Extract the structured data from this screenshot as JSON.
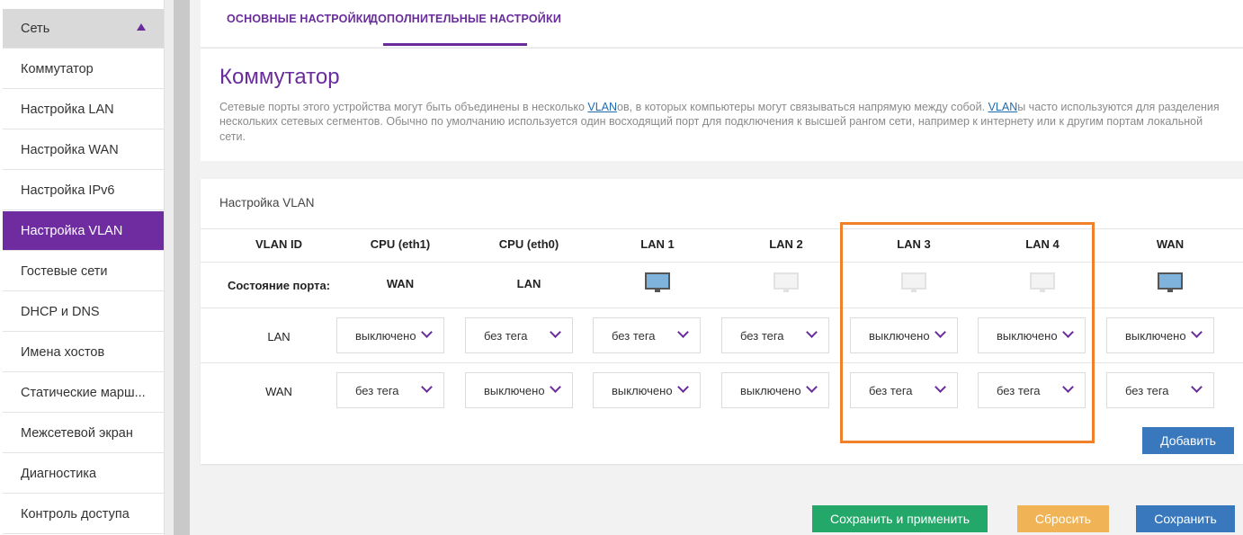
{
  "sidebar": {
    "items": [
      {
        "label": "Сеть"
      },
      {
        "label": "Коммутатор"
      },
      {
        "label": "Настройка LAN"
      },
      {
        "label": "Настройка WAN"
      },
      {
        "label": "Настройка IPv6"
      },
      {
        "label": "Настройка VLAN"
      },
      {
        "label": "Гостевые сети"
      },
      {
        "label": "DHCP и DNS"
      },
      {
        "label": "Имена хостов"
      },
      {
        "label": "Статические марш..."
      },
      {
        "label": "Межсетевой экран"
      },
      {
        "label": "Диагностика"
      },
      {
        "label": "Контроль доступа"
      }
    ]
  },
  "tabs": [
    {
      "label": "ОСНОВНЫЕ НАСТРОЙКИ"
    },
    {
      "label": "ДОПОЛНИТЕЛЬНЫЕ НАСТРОЙКИ"
    }
  ],
  "intro": {
    "title": "Коммутатор",
    "p1": "Сетевые порты этого устройства могут быть объединены в несколько ",
    "link1": "VLAN",
    "p2": "ов, в которых компьютеры могут связываться напрямую между собой. ",
    "link2": "VLAN",
    "p3": "ы часто используются для разделения нескольких сетевых сегментов. Обычно по умолчанию используется один восходящий порт для подключения к высшей рангом сети, например к интернету или к другим портам локальной сети."
  },
  "vlan": {
    "panel_title": "Настройка VLAN",
    "columns": [
      "VLAN ID",
      "CPU (eth1)",
      "CPU (eth0)",
      "LAN 1",
      "LAN 2",
      "LAN 3",
      "LAN 4",
      "WAN"
    ],
    "port_state": {
      "label": "Состояние порта:",
      "cpu_eth1": "WAN",
      "cpu_eth0": "LAN",
      "monitors": {
        "lan1": "connected",
        "lan2": "disconnected",
        "lan3": "disconnected",
        "lan4": "disconnected",
        "wan": "connected"
      }
    },
    "rows": [
      {
        "label": "LAN",
        "values": [
          "выключено",
          "без тега",
          "без тега",
          "без тега",
          "выключено",
          "выключено",
          "выключено"
        ]
      },
      {
        "label": "WAN",
        "values": [
          "без тега",
          "выключено",
          "выключено",
          "выключено",
          "без тега",
          "без тега",
          "без тега"
        ]
      }
    ],
    "add_button": "Добавить"
  },
  "footer": {
    "save_apply": "Сохранить и применить",
    "reset": "Сбросить",
    "save": "Сохранить"
  },
  "colors": {
    "accent": "#6a2c9c",
    "active_nav": "#6f2ca0",
    "highlight": "#f0802a",
    "btn_blue": "#3a78bd",
    "btn_green": "#24a86a",
    "btn_orange": "#f0b456"
  }
}
